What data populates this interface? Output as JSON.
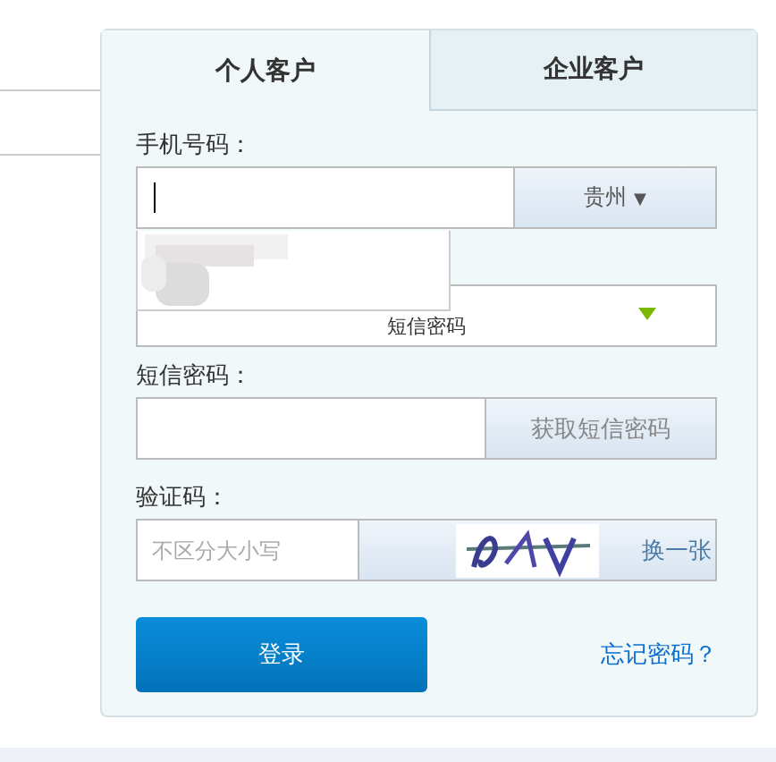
{
  "tabs": [
    {
      "label": "个人客户",
      "selected": true
    },
    {
      "label": "企业客户",
      "selected": false
    }
  ],
  "phone": {
    "label": "手机号码：",
    "region": "贵州",
    "caret": "▼"
  },
  "login_type": {
    "value": "短信密码"
  },
  "sms": {
    "label": "短信密码：",
    "button": "获取短信密码"
  },
  "captcha": {
    "label": "验证码：",
    "placeholder": "不区分大小写",
    "refresh": "换一张"
  },
  "login_button": "登录",
  "forgot_link": "忘记密码？"
}
